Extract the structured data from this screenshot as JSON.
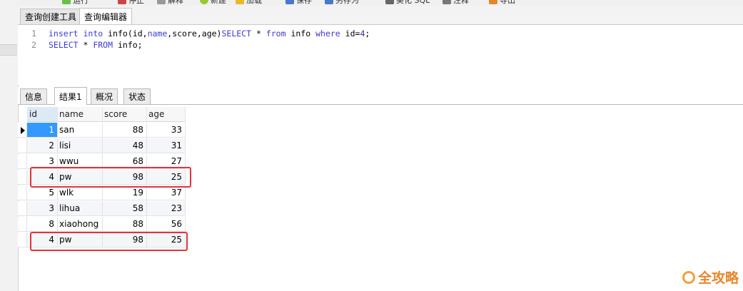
{
  "toolbar": {
    "items": [
      {
        "label": "运行",
        "icon": "run-icon"
      },
      {
        "label": "停止",
        "icon": "stop-icon"
      },
      {
        "label": "解释",
        "icon": "explain-icon"
      },
      {
        "label": "新建",
        "icon": "new-icon"
      },
      {
        "label": "加载",
        "icon": "load-icon"
      },
      {
        "label": "保存",
        "icon": "save-icon"
      },
      {
        "label": "另存为",
        "icon": "save-as-icon"
      },
      {
        "label": "美化 SQL",
        "icon": "beautify-icon"
      },
      {
        "label": "注释",
        "icon": "comment-icon"
      },
      {
        "label": "导出",
        "icon": "export-icon"
      }
    ]
  },
  "editor_tabs": [
    "查询创建工具",
    "查询编辑器"
  ],
  "editor": {
    "line_numbers": [
      "1",
      "2"
    ],
    "lines": [
      "insert into info(id,name,score,age)SELECT * from info where id=4;",
      "SELECT * FROM info;"
    ]
  },
  "result_tabs": [
    "信息",
    "结果1",
    "概况",
    "状态"
  ],
  "grid": {
    "columns": [
      "id",
      "name",
      "score",
      "age"
    ],
    "rows": [
      [
        "1",
        "san",
        "88",
        "33"
      ],
      [
        "2",
        "lisi",
        "48",
        "31"
      ],
      [
        "3",
        "wwu",
        "68",
        "27"
      ],
      [
        "4",
        "pw",
        "98",
        "25"
      ],
      [
        "5",
        "wlk",
        "19",
        "37"
      ],
      [
        "3",
        "lihua",
        "58",
        "23"
      ],
      [
        "8",
        "xiaohong",
        "88",
        "56"
      ],
      [
        "4",
        "pw",
        "98",
        "25"
      ]
    ]
  },
  "colors": {
    "keyword": "#3b3bd6",
    "selected_cell": "#3399ff",
    "highlight_box": "#e0343a"
  },
  "watermark": "全攻略"
}
